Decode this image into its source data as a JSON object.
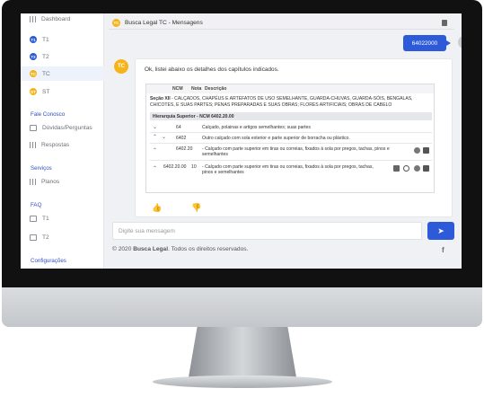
{
  "sidebar": {
    "dashboard_label": "Dashboard",
    "tabs": [
      {
        "label": "T1",
        "badge": "T1",
        "color": "#2c5ad8"
      },
      {
        "label": "T2",
        "badge": "T2",
        "color": "#2c5ad8"
      },
      {
        "label": "TC",
        "badge": "TC",
        "color": "#f4b41a"
      },
      {
        "label": "ST",
        "badge": "ST",
        "color": "#f4b41a"
      }
    ],
    "sections": {
      "fale_conosco": "Fale Conosco",
      "duvidas": "Dúvidas/Perguntas",
      "respostas": "Respostas",
      "servicos": "Serviços",
      "planos": "Planos",
      "faq": "FAQ",
      "faq_t1": "T1",
      "faq_t2": "T2",
      "configuracoes": "Configurações"
    }
  },
  "chat": {
    "title": "Busca Legal TC - Mensagens",
    "avatar_label": "TC",
    "user_message": "64022000",
    "bot_intro": "Ok, listei abaixo os detalhes dos capítulos indicados.",
    "table": {
      "col_ncm": "NCM",
      "col_nota": "Nota",
      "col_descricao": "Descrição",
      "secao_label": "Seção XII",
      "secao_text": " - CALÇADOS, CHAPÉUS E ARTEFATOS DE USO SEMELHANTE, GUARDA-CHUVAS, GUARDA-SÓIS, BENGALAS, CHICOTES, E SUAS PARTES; PENAS PREPARADAS E SUAS OBRAS; FLORES ARTIFICIAIS; OBRAS DE CABELO",
      "hierarquia": "Hierarquia Superior - NCM 6402.20.00",
      "rows": [
        {
          "ncm": "64",
          "nota": "",
          "desc": "Calçado, polainas e artigos semelhantes; suas partes"
        },
        {
          "ncm": "6402",
          "nota": "",
          "desc": "Outro calçado com sola exterior e parte superior de borracha ou plástico."
        },
        {
          "ncm": "6402.20",
          "nota": "",
          "desc": "- Calçado com parte superior em tiras ou correias, fixados à sola por pregos, tachas, pinos e semelhantes"
        },
        {
          "ncm": "6402.20.00",
          "nota": "10",
          "desc": "- Calçado com parte superior em tiras ou correias, fixados à sola por pregos, tachas, pinos e semelhantes"
        }
      ]
    },
    "input_placeholder": "Digite sua mensagem",
    "footer_prefix": "© 2020 ",
    "footer_brand": "Busca Legal",
    "footer_suffix": ". Todos os direitos reservados.",
    "social": "f"
  }
}
